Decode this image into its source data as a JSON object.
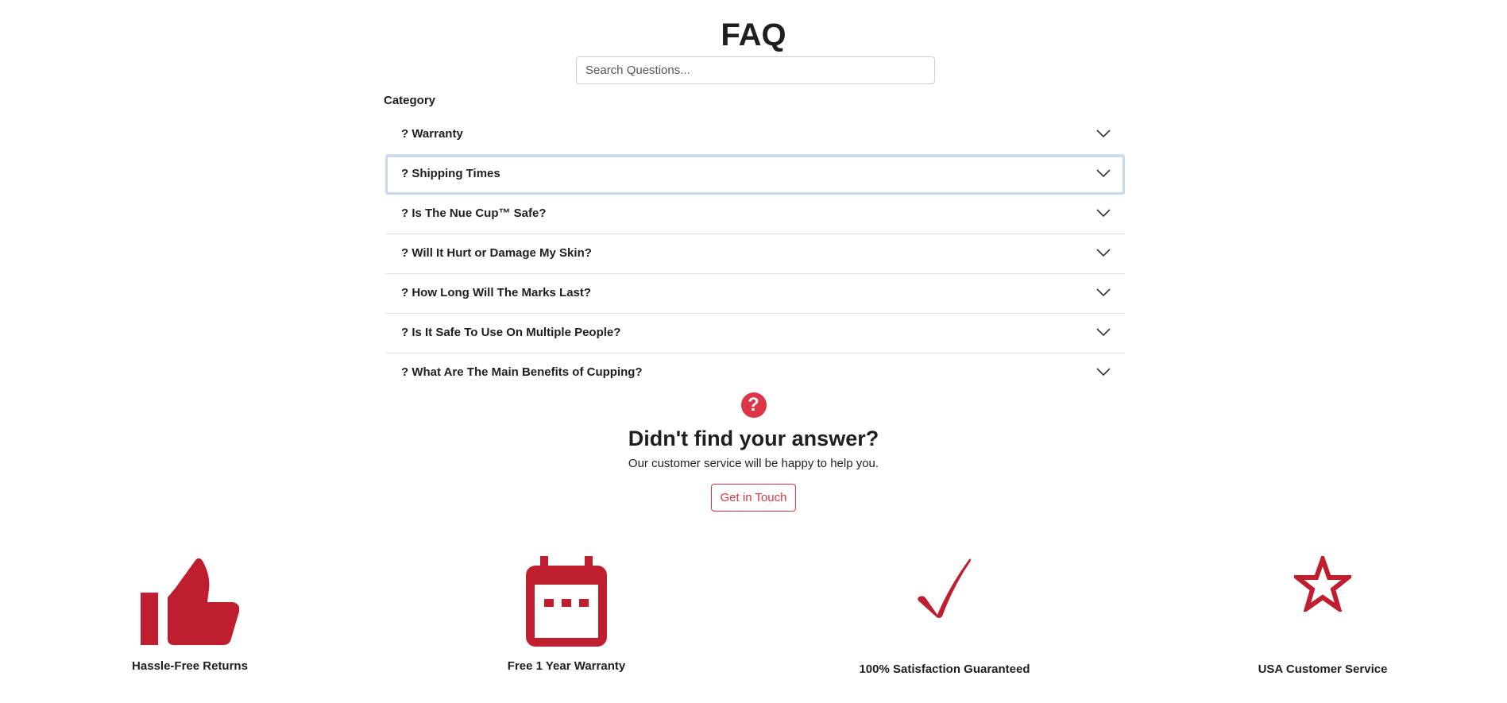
{
  "page": {
    "title": "FAQ",
    "accent_color": "#dc3545",
    "icon_color": "#bf1e2e",
    "focus_color": "#c6d9f4"
  },
  "search": {
    "placeholder": "Search Questions..."
  },
  "category": {
    "label": "Category"
  },
  "faq": {
    "items": [
      {
        "question": "? Warranty",
        "focused": false
      },
      {
        "question": "? Shipping Times",
        "focused": true
      },
      {
        "question": "? Is The Nue Cup™ Safe?",
        "focused": false
      },
      {
        "question": "? Will It Hurt or Damage My Skin?",
        "focused": false
      },
      {
        "question": "? How Long Will The Marks Last?",
        "focused": false
      },
      {
        "question": "? Is It Safe To Use On Multiple People?",
        "focused": false
      },
      {
        "question": "? What Are The Main Benefits of Cupping?",
        "focused": false
      }
    ],
    "chevron_icon": "chevron-down-icon"
  },
  "help": {
    "icon": "question-circle-icon",
    "icon_glyph": "?",
    "title": "Didn't find your answer?",
    "subtitle": "Our customer service will be happy to help you.",
    "button_label": "Get in Touch"
  },
  "features": [
    {
      "icon": "thumbs-up-icon",
      "label": "Hassle-Free Returns"
    },
    {
      "icon": "calendar-icon",
      "label": "Free 1 Year Warranty"
    },
    {
      "icon": "checkmark-icon",
      "label": "100% Satisfaction Guaranteed"
    },
    {
      "icon": "star-icon",
      "label": "USA Customer Service"
    }
  ]
}
